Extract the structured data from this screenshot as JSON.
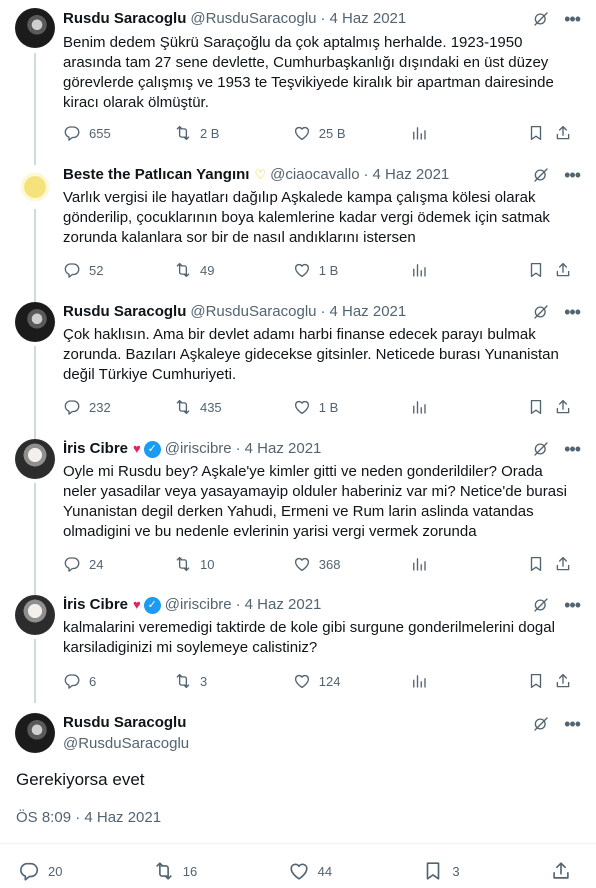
{
  "tweets": [
    {
      "name": "Rusdu Saracoglu",
      "handle": "@RusduSaracoglu",
      "date": "4 Haz 2021",
      "text": "Benim dedem Şükrü Saraçoğlu da çok aptalmış herhalde. 1923-1950 arasında tam 27 sene devlette, Cumhurbaşkanlığı dışındaki en üst düzey görevlerde çalışmış ve 1953 te Teşvikiyede kiralık bir apartman dairesinde kiracı olarak ölmüştür.",
      "replies": "655",
      "retweets": "2 B",
      "likes": "25 B"
    },
    {
      "name": "Beste the Patlıcan Yangını",
      "handle": "@ciaocavallo",
      "date": "4 Haz 2021",
      "text": "Varlık vergisi ile hayatları dağılıp Aşkalede kampa çalışma kölesi olarak gönderilip, çocuklarının boya kalemlerine kadar vergi ödemek için satmak zorunda kalanlara sor bir de nasıl andıklarını istersen",
      "replies": "52",
      "retweets": "49",
      "likes": "1 B"
    },
    {
      "name": "Rusdu Saracoglu",
      "handle": "@RusduSaracoglu",
      "date": "4 Haz 2021",
      "text": "Çok haklısın. Ama bir devlet adamı harbi finanse edecek parayı bulmak zorunda. Bazıları Aşkaleye gidecekse gitsinler. Neticede burası Yunanistan değil Türkiye Cumhuriyeti.",
      "replies": "232",
      "retweets": "435",
      "likes": "1 B"
    },
    {
      "name": "İris Cibre",
      "handle": "@iriscibre",
      "date": "4 Haz 2021",
      "text": "Oyle mi Rusdu bey? Aşkale'ye kimler gitti ve neden gonderildiler? Orada neler yasadilar veya yasayamayip olduler haberiniz var mi? Netice'de burasi Yunanistan degil derken Yahudi, Ermeni ve Rum larin aslinda vatandas olmadigini ve bu nedenle evlerinin yarisi vergi vermek zorunda",
      "replies": "24",
      "retweets": "10",
      "likes": "368"
    },
    {
      "name": "İris Cibre",
      "handle": "@iriscibre",
      "date": "4 Haz 2021",
      "text": "kalmalarini veremedigi taktirde de kole gibi surgune gonderilmelerini dogal karsiladiginizi mi soylemeye calistiniz?",
      "replies": "6",
      "retweets": "3",
      "likes": "124"
    }
  ],
  "focus": {
    "name": "Rusdu Saracoglu",
    "handle": "@RusduSaracoglu",
    "text": "Gerekiyorsa evet",
    "timestamp": "ÖS 8:09 · 4 Haz 2021",
    "replies": "20",
    "retweets": "16",
    "likes": "44",
    "bookmarks": "3"
  },
  "separator": "·",
  "icons": [
    "reply-icon",
    "retweet-icon",
    "like-icon",
    "views-icon",
    "bookmark-icon",
    "share-icon",
    "grok-icon",
    "more-icon",
    "heart-badge-icon",
    "verified-icon"
  ],
  "colors": {
    "text": "#0f1419",
    "secondary": "#536471",
    "verified": "#1d9bf0",
    "line": "#cfd9de"
  }
}
